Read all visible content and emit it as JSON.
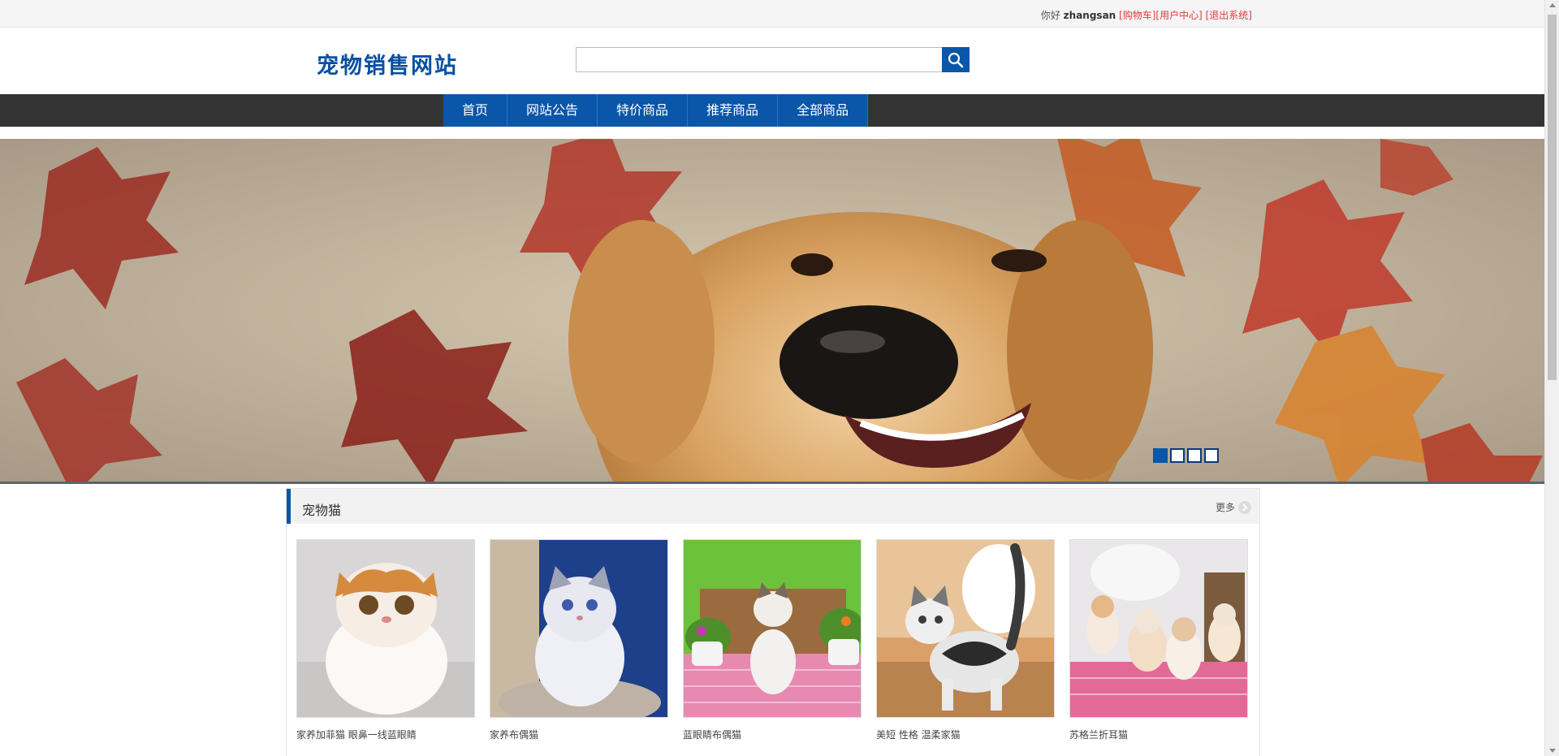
{
  "topbar": {
    "greeting": "你好",
    "username": "zhangsan",
    "links": [
      "[购物车]",
      "[用户中心]",
      "[退出系统]"
    ]
  },
  "header": {
    "logo": "宠物销售网站",
    "search_value": "",
    "search_icon": "search-icon"
  },
  "nav": {
    "items": [
      "首页",
      "网站公告",
      "特价商品",
      "推荐商品",
      "全部商品"
    ]
  },
  "banner": {
    "slide_count": 4,
    "active_slide": 1
  },
  "section": {
    "title": "宠物猫",
    "more_label": "更多",
    "products": [
      {
        "name": "家养加菲猫 眼鼻一线蓝眼睛"
      },
      {
        "name": "家养布偶猫"
      },
      {
        "name": "蓝眼睛布偶猫"
      },
      {
        "name": "美短 性格 温柔家猫"
      },
      {
        "name": "苏格兰折耳猫"
      }
    ]
  },
  "colors": {
    "brand_blue": "#0a56a8",
    "nav_bg": "#333333",
    "link_red": "#e4393c"
  }
}
